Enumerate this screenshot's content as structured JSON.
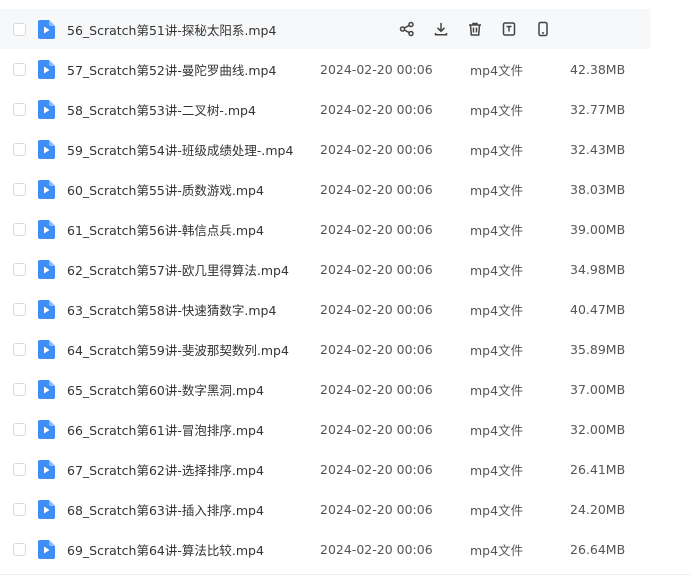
{
  "colors": {
    "accent": "#3f8ef7",
    "text_primary": "#333333",
    "text_secondary": "#555555",
    "hover_row": "#f7f8fa"
  },
  "hover_actions": [
    {
      "name": "share-icon"
    },
    {
      "name": "download-icon"
    },
    {
      "name": "delete-icon"
    },
    {
      "name": "rename-icon"
    },
    {
      "name": "phone-icon"
    }
  ],
  "files": [
    {
      "name": "56_Scratch第51讲-探秘太阳系.mp4",
      "date": "",
      "type": "",
      "size": ""
    },
    {
      "name": "57_Scratch第52讲-曼陀罗曲线.mp4",
      "date": "2024-02-20 00:06",
      "type": "mp4文件",
      "size": "42.38MB"
    },
    {
      "name": "58_Scratch第53讲-二叉树-.mp4",
      "date": "2024-02-20 00:06",
      "type": "mp4文件",
      "size": "32.77MB"
    },
    {
      "name": "59_Scratch第54讲-班级成绩处理-.mp4",
      "date": "2024-02-20 00:06",
      "type": "mp4文件",
      "size": "32.43MB"
    },
    {
      "name": "60_Scratch第55讲-质数游戏.mp4",
      "date": "2024-02-20 00:06",
      "type": "mp4文件",
      "size": "38.03MB"
    },
    {
      "name": "61_Scratch第56讲-韩信点兵.mp4",
      "date": "2024-02-20 00:06",
      "type": "mp4文件",
      "size": "39.00MB"
    },
    {
      "name": "62_Scratch第57讲-欧几里得算法.mp4",
      "date": "2024-02-20 00:06",
      "type": "mp4文件",
      "size": "34.98MB"
    },
    {
      "name": "63_Scratch第58讲-快速猜数字.mp4",
      "date": "2024-02-20 00:06",
      "type": "mp4文件",
      "size": "40.47MB"
    },
    {
      "name": "64_Scratch第59讲-斐波那契数列.mp4",
      "date": "2024-02-20 00:06",
      "type": "mp4文件",
      "size": "35.89MB"
    },
    {
      "name": "65_Scratch第60讲-数字黑洞.mp4",
      "date": "2024-02-20 00:06",
      "type": "mp4文件",
      "size": "37.00MB"
    },
    {
      "name": "66_Scratch第61讲-冒泡排序.mp4",
      "date": "2024-02-20 00:06",
      "type": "mp4文件",
      "size": "32.00MB"
    },
    {
      "name": "67_Scratch第62讲-选择排序.mp4",
      "date": "2024-02-20 00:06",
      "type": "mp4文件",
      "size": "26.41MB"
    },
    {
      "name": "68_Scratch第63讲-插入排序.mp4",
      "date": "2024-02-20 00:06",
      "type": "mp4文件",
      "size": "24.20MB"
    },
    {
      "name": "69_Scratch第64讲-算法比较.mp4",
      "date": "2024-02-20 00:06",
      "type": "mp4文件",
      "size": "26.64MB"
    }
  ]
}
